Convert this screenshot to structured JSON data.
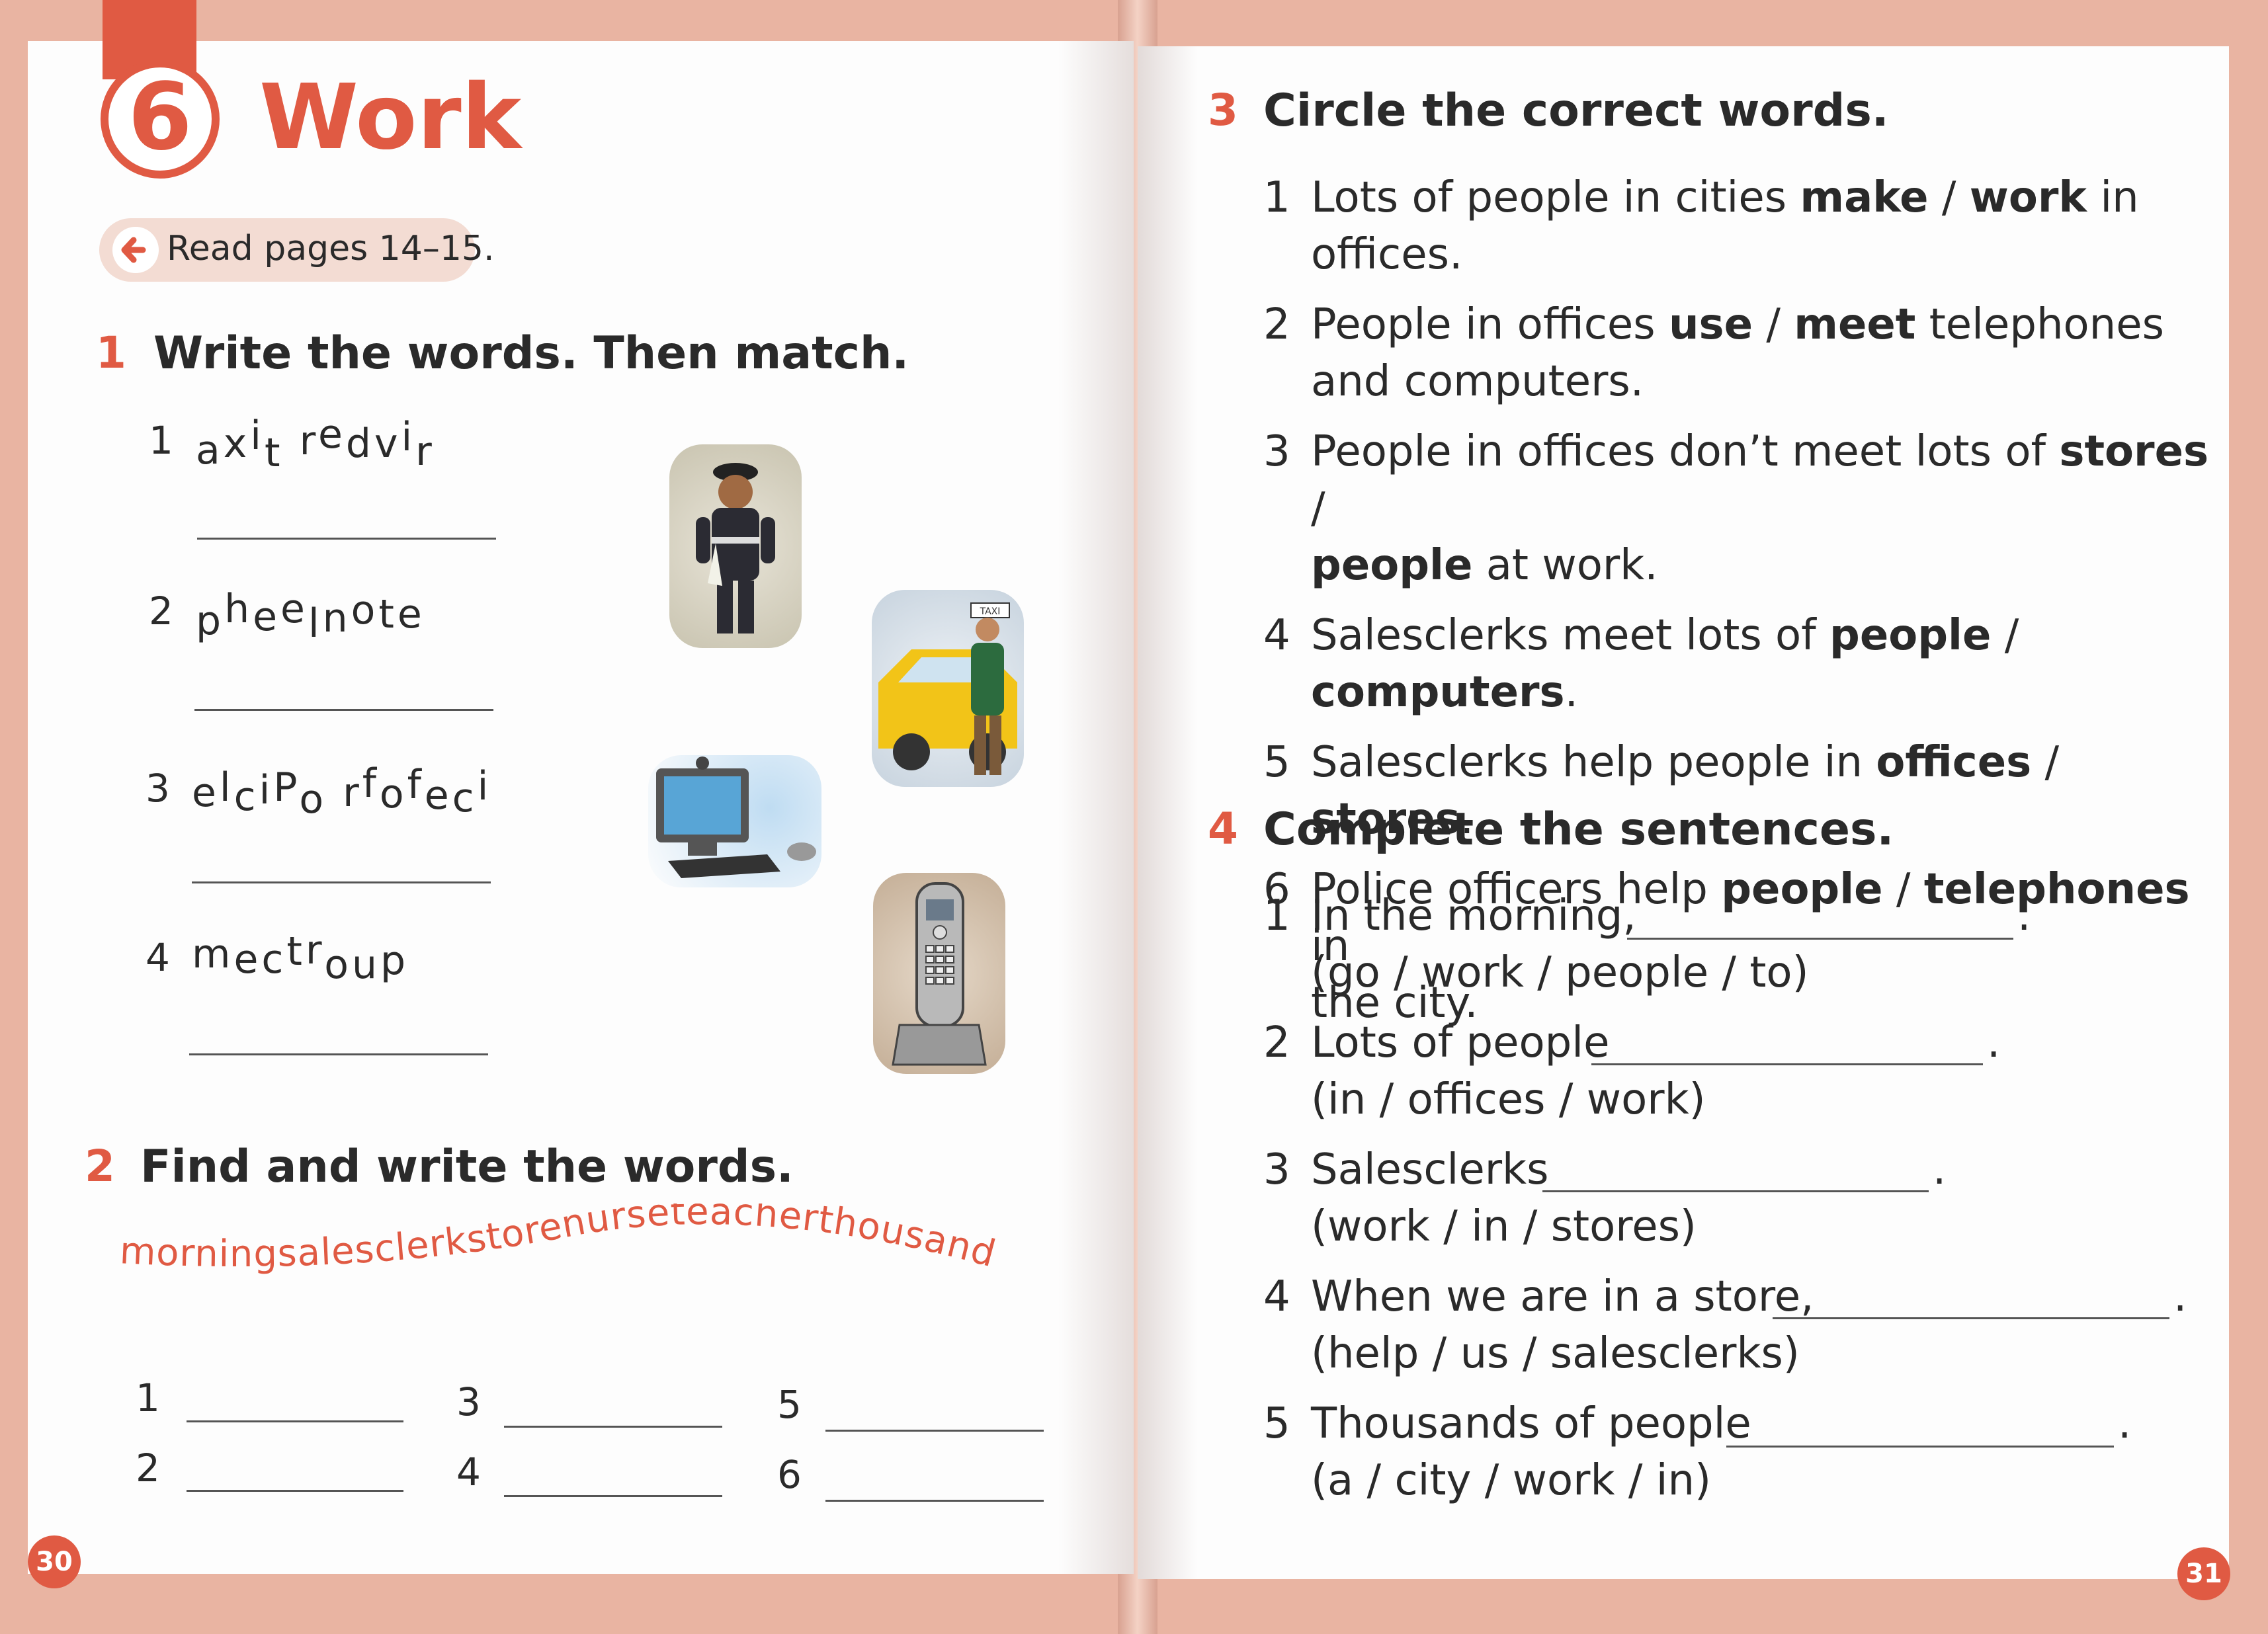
{
  "unit": {
    "number": "6",
    "title": "Work",
    "read_note": "Read pages 14–15."
  },
  "exercise1": {
    "number": "1",
    "title": "Write the words. Then match.",
    "items": [
      {
        "num": "1",
        "scrambled": "axit redvir"
      },
      {
        "num": "2",
        "scrambled": "pheelnote"
      },
      {
        "num": "3",
        "scrambled": "elcipo rfofeci"
      },
      {
        "num": "4",
        "scrambled": "mectroup"
      }
    ]
  },
  "exercise2": {
    "number": "2",
    "title": "Find and write the words.",
    "word_string": "morningsalesclerkstorenurseteacherthousand",
    "answer_nums": [
      "1",
      "2",
      "3",
      "4",
      "5",
      "6"
    ]
  },
  "exercise3": {
    "number": "3",
    "title": "Circle the correct words.",
    "items": [
      {
        "num": "1",
        "lines": [
          [
            [
              "Lots of people in cities ",
              false
            ],
            [
              "make",
              true
            ],
            [
              " / ",
              false
            ],
            [
              "work",
              true
            ],
            [
              " in offices.",
              false
            ]
          ]
        ]
      },
      {
        "num": "2",
        "lines": [
          [
            [
              "People in offices ",
              false
            ],
            [
              "use",
              true
            ],
            [
              " / ",
              false
            ],
            [
              "meet",
              true
            ],
            [
              " telephones",
              false
            ]
          ],
          [
            [
              "and computers.",
              false
            ]
          ]
        ]
      },
      {
        "num": "3",
        "lines": [
          [
            [
              "People in offices don’t meet lots of ",
              false
            ],
            [
              "stores",
              true
            ],
            [
              " /",
              false
            ]
          ],
          [
            [
              "people",
              true
            ],
            [
              " at work.",
              false
            ]
          ]
        ]
      },
      {
        "num": "4",
        "lines": [
          [
            [
              "Salesclerks meet lots of ",
              false
            ],
            [
              "people",
              true
            ],
            [
              " / ",
              false
            ],
            [
              "computers",
              true
            ],
            [
              ".",
              false
            ]
          ]
        ]
      },
      {
        "num": "5",
        "lines": [
          [
            [
              "Salesclerks help people in ",
              false
            ],
            [
              "offices",
              true
            ],
            [
              " / ",
              false
            ],
            [
              "stores",
              true
            ],
            [
              ".",
              false
            ]
          ]
        ]
      },
      {
        "num": "6",
        "lines": [
          [
            [
              "Police officers help ",
              false
            ],
            [
              "people",
              true
            ],
            [
              " / ",
              false
            ],
            [
              "telephones",
              true
            ],
            [
              " in",
              false
            ]
          ],
          [
            [
              "the city.",
              false
            ]
          ]
        ]
      }
    ]
  },
  "exercise4": {
    "number": "4",
    "title": "Complete the sentences.",
    "items": [
      {
        "num": "1",
        "prompt": "In the morning,",
        "end": ".",
        "hint": "(go / work / people / to)"
      },
      {
        "num": "2",
        "prompt": "Lots of people",
        "end": ".",
        "hint": "(in / offices / work)"
      },
      {
        "num": "3",
        "prompt": "Salesclerks",
        "end": ".",
        "hint": "(work / in / stores)"
      },
      {
        "num": "4",
        "prompt": "When we are in a store,",
        "end": ".",
        "hint": "(help / us / salesclerks)"
      },
      {
        "num": "5",
        "prompt": "Thousands of people",
        "end": ".",
        "hint": "(a / city / work / in)"
      }
    ]
  },
  "picture_labels": {
    "taxi_sign": "TAXI",
    "phone_keys": [
      "1",
      "2",
      "3",
      "4",
      "5",
      "6",
      "7",
      "8",
      "9",
      "*",
      "0",
      "#"
    ]
  },
  "page_numbers": {
    "left": "30",
    "right": "31"
  },
  "colors": {
    "accent": "#e05a43",
    "background": "#e9b4a2"
  }
}
